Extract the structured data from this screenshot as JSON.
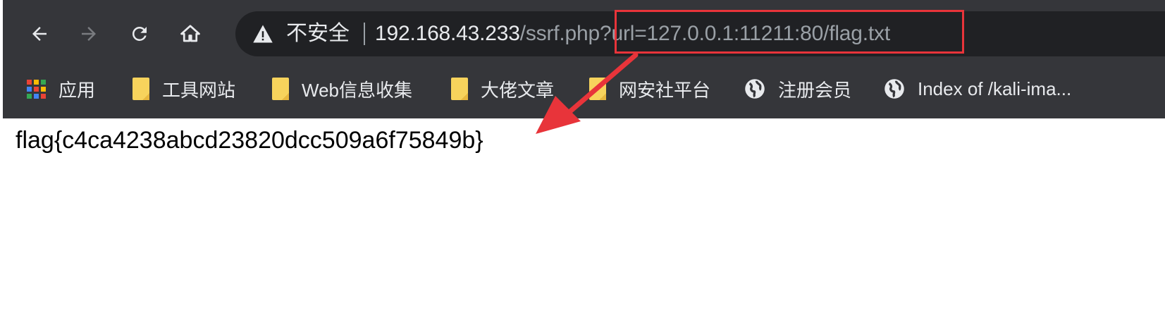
{
  "toolbar": {
    "back_icon": "arrow-left-icon",
    "forward_icon": "arrow-right-icon",
    "reload_icon": "reload-icon",
    "home_icon": "home-icon"
  },
  "omnibox": {
    "security_label": "不安全",
    "url_host": "192.168.43.233",
    "url_path": "/ssrf.php?url=127.0.0.1:11211:80/flag.txt",
    "warning_icon": "warning-triangle-icon"
  },
  "bookmarks": {
    "items": [
      {
        "label": "应用",
        "icon": "apps-grid-icon"
      },
      {
        "label": "工具网站",
        "icon": "folder-icon"
      },
      {
        "label": "Web信息收集",
        "icon": "folder-icon"
      },
      {
        "label": "大佬文章",
        "icon": "folder-icon"
      },
      {
        "label": "网安社平台",
        "icon": "folder-icon"
      },
      {
        "label": "注册会员",
        "icon": "globe-icon"
      },
      {
        "label": "Index of /kali-ima...",
        "icon": "globe-icon"
      }
    ]
  },
  "page": {
    "body_text": "flag{c4ca4238abcd23820dcc509a6f75849b}"
  },
  "annotations": {
    "highlight_color": "#e8343a",
    "arrow_color": "#e8343a"
  }
}
